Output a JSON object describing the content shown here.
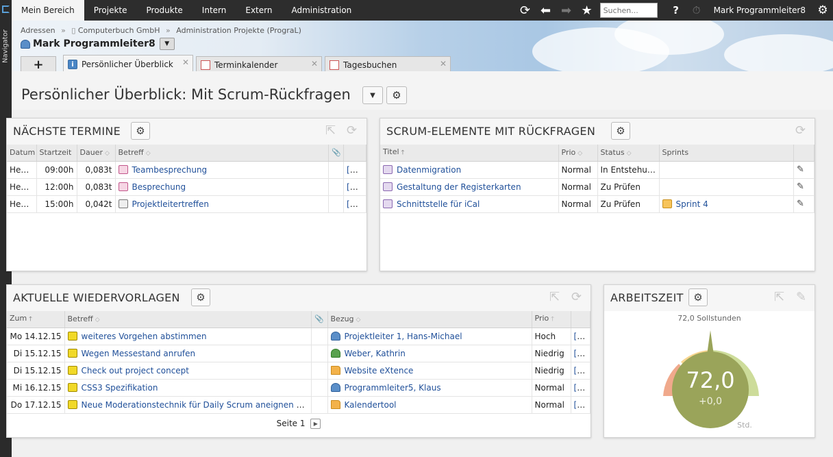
{
  "navigator": {
    "label": "Navigator"
  },
  "topbar": {
    "menu": [
      {
        "label": "Mein Bereich",
        "active": true
      },
      {
        "label": "Projekte"
      },
      {
        "label": "Produkte"
      },
      {
        "label": "Intern"
      },
      {
        "label": "Extern"
      },
      {
        "label": "Administration"
      }
    ],
    "search_placeholder": "Suchen...",
    "help": "?",
    "user": "Mark Programmleiter8"
  },
  "breadcrumb": [
    "Adressen",
    "Computerbuch GmbH",
    "Administration Projekte (PrograL)"
  ],
  "context": {
    "name": "Mark Programmleiter8"
  },
  "tabs": [
    {
      "label": "Persönlicher Überblick",
      "active": true
    },
    {
      "label": "Terminkalender"
    },
    {
      "label": "Tagesbuchen"
    }
  ],
  "page": {
    "title": "Persönlicher Überblick: Mit Scrum-Rückfragen"
  },
  "termine": {
    "title": "NÄCHSTE TERMINE",
    "columns": [
      "Datum",
      "Startzeit",
      "Dauer",
      "Betreff"
    ],
    "rows": [
      {
        "datum": "Heute",
        "start": "09:00h",
        "dauer": "0,083t",
        "betreff": "Teambesprechung",
        "ok": "[Ok]"
      },
      {
        "datum": "Heute",
        "start": "12:00h",
        "dauer": "0,083t",
        "betreff": "Besprechung",
        "ok": "[Ok]"
      },
      {
        "datum": "Heute",
        "start": "15:00h",
        "dauer": "0,042t",
        "betreff": "Projektleitertreffen",
        "ok": "[Ok]"
      }
    ]
  },
  "scrum": {
    "title": "SCRUM-ELEMENTE MIT RÜCKFRAGEN",
    "columns": [
      "Titel",
      "Prio",
      "Status",
      "Sprints"
    ],
    "rows": [
      {
        "titel": "Datenmigration",
        "prio": "Normal",
        "status": "In Entstehung",
        "sprint": ""
      },
      {
        "titel": "Gestaltung der Registerkarten",
        "prio": "Normal",
        "status": "Zu Prüfen",
        "sprint": ""
      },
      {
        "titel": "Schnittstelle für iCal",
        "prio": "Normal",
        "status": "Zu Prüfen",
        "sprint": "Sprint 4"
      }
    ]
  },
  "wiedervorlagen": {
    "title": "AKTUELLE WIEDERVORLAGEN",
    "columns": [
      "Zum",
      "Betreff",
      "Bezug",
      "Prio"
    ],
    "rows": [
      {
        "zum": "Mo 14.12.15",
        "betreff": "weiteres Vorgehen abstimmen",
        "bezug": "Projektleiter 1, Hans-Michael",
        "prio": "Hoch",
        "ok": "[Ok]"
      },
      {
        "zum": "Di 15.12.15",
        "betreff": "Wegen Messestand anrufen",
        "bezug": "Weber, Kathrin",
        "prio": "Niedrig",
        "ok": "[Ok]"
      },
      {
        "zum": "Di 15.12.15",
        "betreff": "Check out project concept",
        "bezug": "Website eXtence",
        "prio": "Niedrig",
        "ok": "[Ok]"
      },
      {
        "zum": "Mi 16.12.15",
        "betreff": "CSS3 Spezifikation",
        "bezug": "Programmleiter5, Klaus",
        "prio": "Normal",
        "ok": "[Ok]"
      },
      {
        "zum": "Do 17.12.15",
        "betreff": "Neue Moderationstechnik für Daily Scrum aneignen und",
        "bezug": "Kalendertool",
        "prio": "Normal",
        "ok": "[Ok]"
      }
    ],
    "pager": "Seite 1"
  },
  "arbeitszeit": {
    "title": "ARBEITSZEIT",
    "soll_label": "72,0 Sollstunden",
    "value": "72,0",
    "delta": "+0,0",
    "unit": "Std.",
    "colors": {
      "low": "#f0a98c",
      "mid": "#f8d690",
      "high": "#cddc9a",
      "center": "#9aa45a"
    }
  }
}
